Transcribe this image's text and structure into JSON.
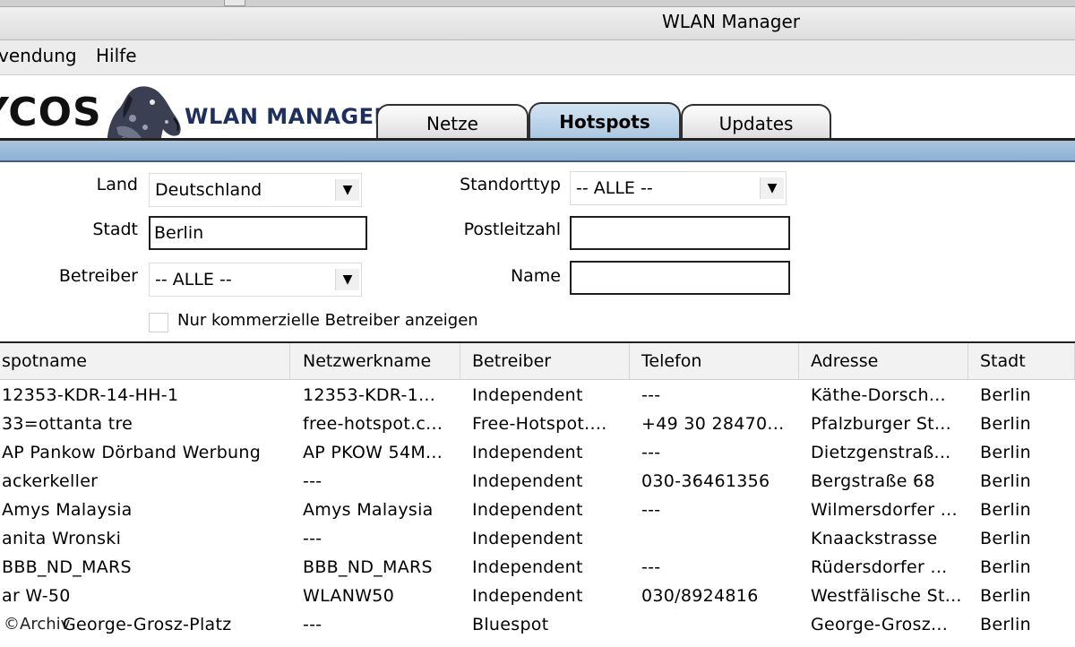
{
  "window": {
    "title": "WLAN Manager"
  },
  "menu": {
    "items": [
      "vendung",
      "Hilfe"
    ]
  },
  "header": {
    "logo_text": "YCOS",
    "product_name": "WLAN MANAGER",
    "tabs": [
      {
        "label": "Netze",
        "active": false
      },
      {
        "label": "Hotspots",
        "active": true
      },
      {
        "label": "Updates",
        "active": false
      }
    ]
  },
  "form": {
    "land": {
      "label": "Land",
      "value": "Deutschland"
    },
    "stadt": {
      "label": "Stadt",
      "value": "Berlin"
    },
    "betreiber": {
      "label": "Betreiber",
      "value": "-- ALLE --"
    },
    "standorttyp": {
      "label": "Standorttyp",
      "value": "-- ALLE --"
    },
    "postleitzahl": {
      "label": "Postleitzahl",
      "value": ""
    },
    "name": {
      "label": "Name",
      "value": ""
    },
    "commercial_only": {
      "label": "Nur kommerzielle Betreiber anzeigen",
      "checked": false
    }
  },
  "table": {
    "columns": [
      "spotname",
      "Netzwerkname",
      "Betreiber",
      "Telefon",
      "Adresse",
      "Stadt"
    ],
    "rows": [
      [
        "12353-KDR-14-HH-1",
        "12353-KDR-1...",
        "Independent",
        "---",
        "Käthe-Dorsch...",
        "Berlin"
      ],
      [
        "33=ottanta tre",
        "free-hotspot.c...",
        "Free-Hotspot....",
        "+49 30 28470...",
        "Pfalzburger St...",
        "Berlin"
      ],
      [
        "AP Pankow Dörband Werbung",
        "AP PKOW 54M...",
        "Independent",
        "---",
        "Dietzgenstraß...",
        "Berlin"
      ],
      [
        "ackerkeller",
        "---",
        "Independent",
        "030-36461356",
        "Bergstraße 68",
        "Berlin"
      ],
      [
        "Amys Malaysia",
        "Amys Malaysia",
        "Independent",
        "---",
        "Wilmersdorfer ...",
        "Berlin"
      ],
      [
        "anita Wronski",
        "---",
        "Independent",
        "",
        "Knaackstrasse",
        "Berlin"
      ],
      [
        "BBB_ND_MARS",
        "BBB_ND_MARS",
        "Independent",
        "---",
        "Rüdersdorfer ...",
        "Berlin"
      ],
      [
        "ar W-50",
        "WLANW50",
        "Independent",
        "030/8924816",
        "Westfälische St...",
        "Berlin"
      ],
      [
        "George-Grosz-Platz",
        "---",
        "Bluespot",
        "",
        "George-Grosz...",
        "Berlin"
      ]
    ]
  },
  "watermark": "©Archiv"
}
